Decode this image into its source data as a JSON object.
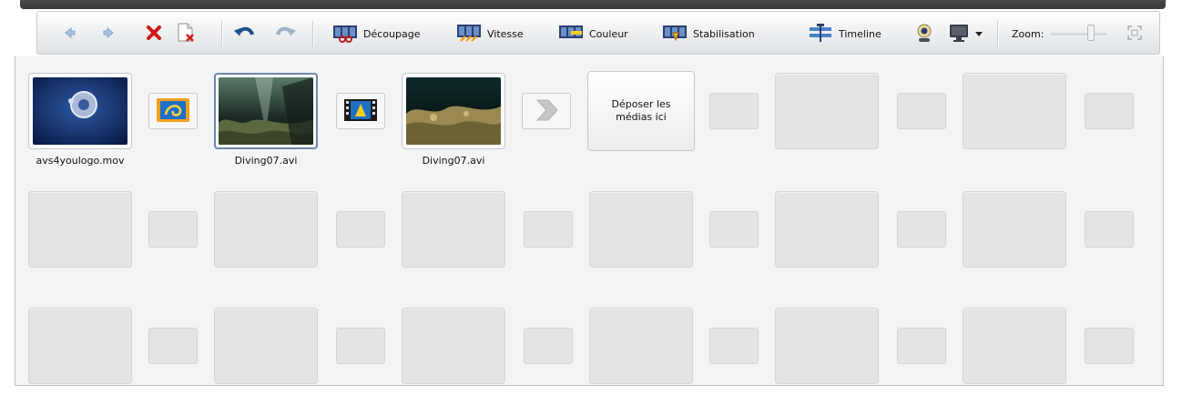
{
  "toolbar": {
    "back_icon": "arrow-left-icon",
    "forward_icon": "arrow-right-icon",
    "delete_icon": "red-x-icon",
    "remove_file_icon": "document-remove-icon",
    "undo_icon": "undo-icon",
    "redo_icon": "redo-icon",
    "buttons": [
      {
        "id": "decoupage",
        "label": "Découpage",
        "icon": "cut-film-icon"
      },
      {
        "id": "vitesse",
        "label": "Vitesse",
        "icon": "speed-film-icon"
      },
      {
        "id": "couleur",
        "label": "Couleur",
        "icon": "color-film-icon"
      },
      {
        "id": "stabilisation",
        "label": "Stabilisation",
        "icon": "stabilization-icon"
      },
      {
        "id": "timeline",
        "label": "Timeline",
        "icon": "timeline-icon"
      }
    ],
    "webcam_icon": "webcam-icon",
    "monitor_icon": "monitor-icon",
    "zoom_label": "Zoom:",
    "zoom_level": 0.75,
    "fit_icon": "fit-window-icon"
  },
  "storyboard": {
    "clips": [
      {
        "filename": "avs4youlogo.mov",
        "kind": "logo"
      },
      {
        "filename": "Diving07.avi",
        "kind": "underwater",
        "selected": true
      },
      {
        "filename": "Diving07.avi",
        "kind": "reef"
      }
    ],
    "transitions": [
      "blue-transition-icon",
      "film-transition-icon",
      "arrow-transition-icon"
    ],
    "drop_zone_label": "Déposer les médias ici"
  },
  "colors": {
    "selection_border": "#6e87ad",
    "delete_red": "#d01818",
    "slot_fill": "#e3e4e5"
  }
}
